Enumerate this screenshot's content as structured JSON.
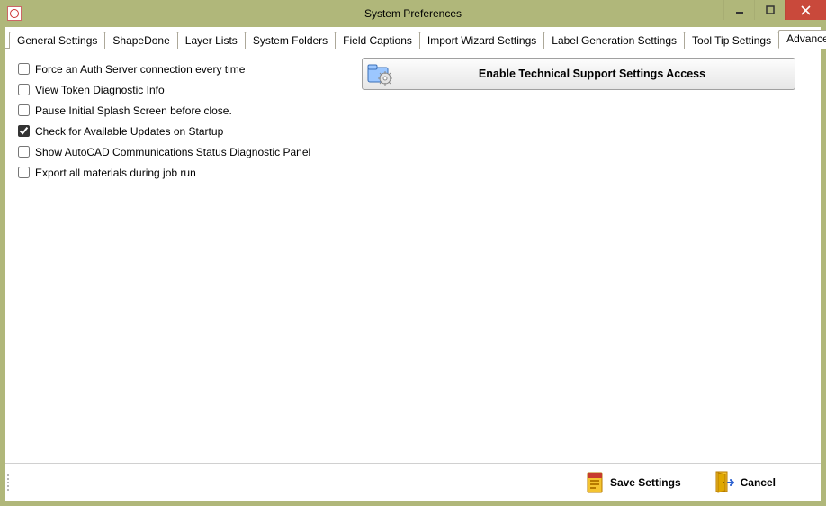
{
  "window": {
    "title": "System Preferences"
  },
  "tabs": [
    {
      "label": "General Settings",
      "active": false
    },
    {
      "label": "ShapeDone",
      "active": false
    },
    {
      "label": "Layer Lists",
      "active": false
    },
    {
      "label": "System Folders",
      "active": false
    },
    {
      "label": "Field Captions",
      "active": false
    },
    {
      "label": "Import Wizard Settings",
      "active": false
    },
    {
      "label": "Label Generation Settings",
      "active": false
    },
    {
      "label": "Tool Tip Settings",
      "active": false
    },
    {
      "label": "Advanced Settings",
      "active": true
    }
  ],
  "advanced": {
    "checks": [
      {
        "label": "Force an Auth Server connection every time",
        "checked": false
      },
      {
        "label": "View Token Diagnostic Info",
        "checked": false
      },
      {
        "label": "Pause Initial Splash Screen before close.",
        "checked": false
      },
      {
        "label": "Check for Available Updates on Startup",
        "checked": true
      },
      {
        "label": "Show AutoCAD Communications Status Diagnostic Panel",
        "checked": false
      },
      {
        "label": "Export all materials during job run",
        "checked": false
      }
    ],
    "support_button": "Enable Technical Support Settings Access"
  },
  "footer": {
    "save": "Save Settings",
    "cancel": "Cancel"
  }
}
